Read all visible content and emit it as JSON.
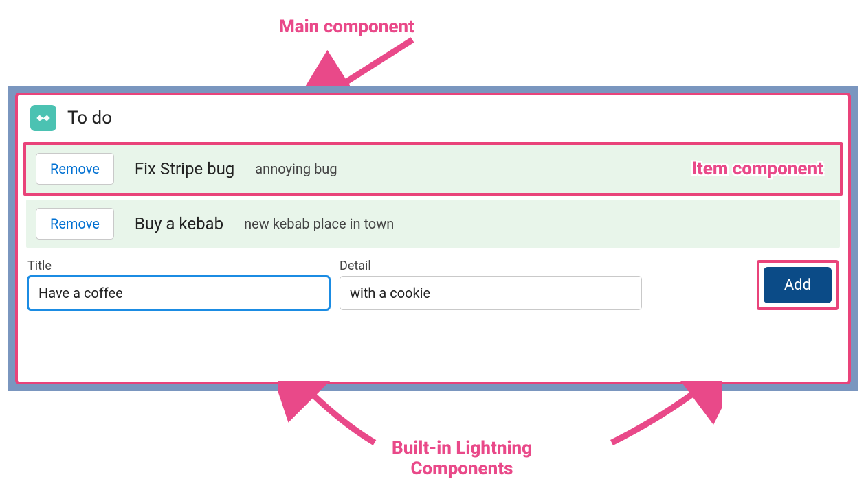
{
  "annotations": {
    "main_component": "Main component",
    "item_component": "Item component",
    "builtin_components": "Built-in Lightning\nComponents"
  },
  "card": {
    "icon_name": "handshake-icon",
    "title": "To do"
  },
  "items": [
    {
      "remove_label": "Remove",
      "title": "Fix Stripe bug",
      "detail": "annoying bug"
    },
    {
      "remove_label": "Remove",
      "title": "Buy a kebab",
      "detail": "new kebab place in town"
    }
  ],
  "form": {
    "title_label": "Title",
    "title_value": "Have a coffee",
    "detail_label": "Detail",
    "detail_value": "with a cookie",
    "add_label": "Add"
  },
  "colors": {
    "highlight": "#e9437a",
    "pink_text": "#e94989",
    "item_bg": "#e8f5ea",
    "icon_bg": "#4bc2b2",
    "add_bg": "#0b4b87",
    "link": "#0070d2",
    "frame_bg": "#7a96bf"
  }
}
